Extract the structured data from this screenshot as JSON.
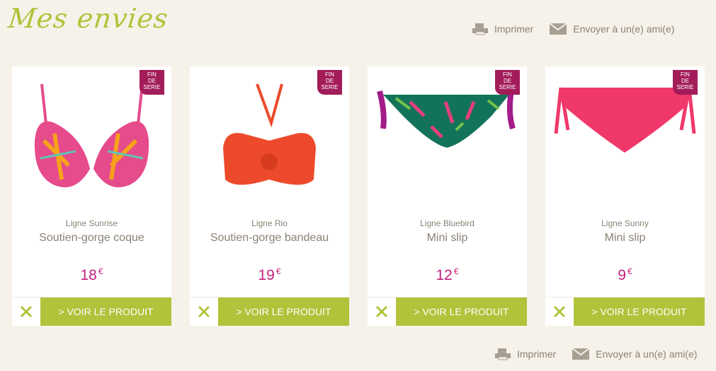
{
  "page": {
    "title": "Mes envies"
  },
  "actions": {
    "print_label": "Imprimer",
    "send_label": "Envoyer à un(e) ami(e)"
  },
  "badge_text": [
    "FIN",
    "DE",
    "SERIE"
  ],
  "view_label": "> VOIR LE PRODUIT",
  "currency": "€",
  "products": [
    {
      "line": "Ligne Sunrise",
      "name": "Soutien-gorge coque",
      "price": "18"
    },
    {
      "line": "Ligne Rio",
      "name": "Soutien-gorge bandeau",
      "price": "19"
    },
    {
      "line": "Ligne Bluebird",
      "name": "Mini slip",
      "price": "12"
    },
    {
      "line": "Ligne Sunny",
      "name": "Mini slip",
      "price": "9"
    }
  ],
  "colors": {
    "accent": "#b2c23a",
    "price": "#c41f7d",
    "badge": "#a31c5a"
  }
}
